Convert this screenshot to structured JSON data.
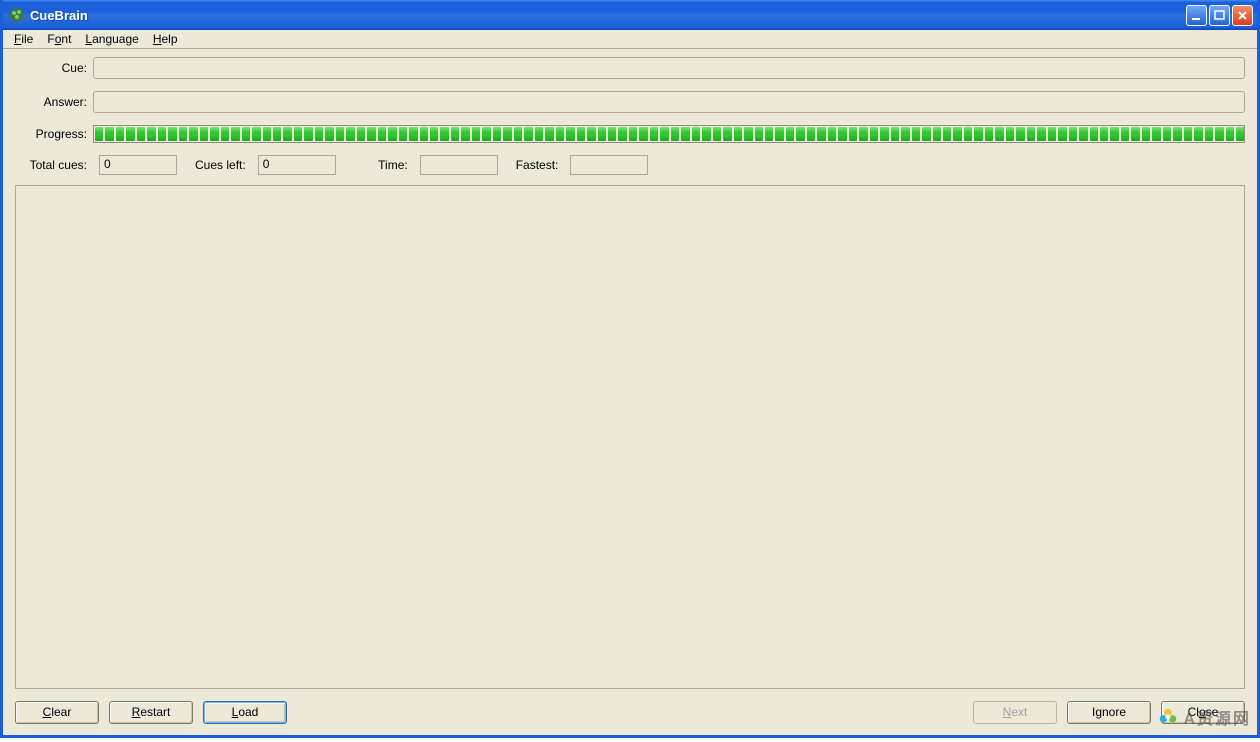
{
  "window": {
    "title": "CueBrain"
  },
  "menubar": {
    "file": "File",
    "font": "Font",
    "language": "Language",
    "help": "Help"
  },
  "labels": {
    "cue": "Cue:",
    "answer": "Answer:",
    "progress": "Progress:",
    "total_cues": "Total cues:",
    "cues_left": "Cues left:",
    "time": "Time:",
    "fastest": "Fastest:"
  },
  "values": {
    "cue": "",
    "answer": "",
    "total_cues": "0",
    "cues_left": "0",
    "time": "",
    "fastest": ""
  },
  "buttons": {
    "clear": "Clear",
    "restart": "Restart",
    "load": "Load",
    "next": "Next",
    "ignore": "Ignore",
    "close": "Close"
  },
  "watermark": {
    "text": "A资源网"
  }
}
